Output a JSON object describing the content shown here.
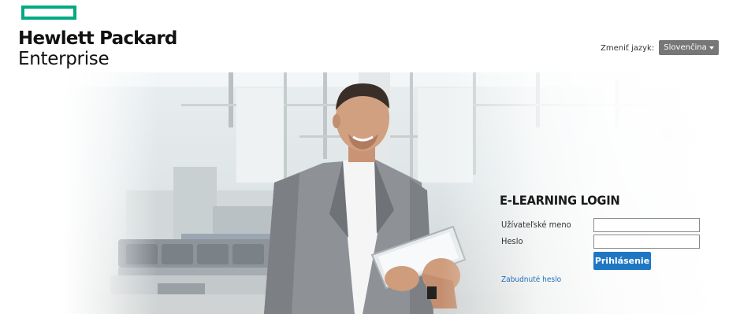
{
  "header": {
    "logo_line1": "Hewlett Packard",
    "logo_line2": "Enterprise",
    "logo_color": "#01a982"
  },
  "language": {
    "label": "Zmeniť jazyk:",
    "selected": "Slovenčina"
  },
  "login": {
    "title": "E-LEARNING LOGIN",
    "username_label": "Užívateľské meno",
    "username_value": "",
    "password_label": "Heslo",
    "password_value": "",
    "submit_label": "Prihlásenie",
    "forgot_label": "Zabudnuté heslo",
    "accent_color": "#1f77c3"
  },
  "hero": {
    "image": "man-with-tablet-photo"
  }
}
